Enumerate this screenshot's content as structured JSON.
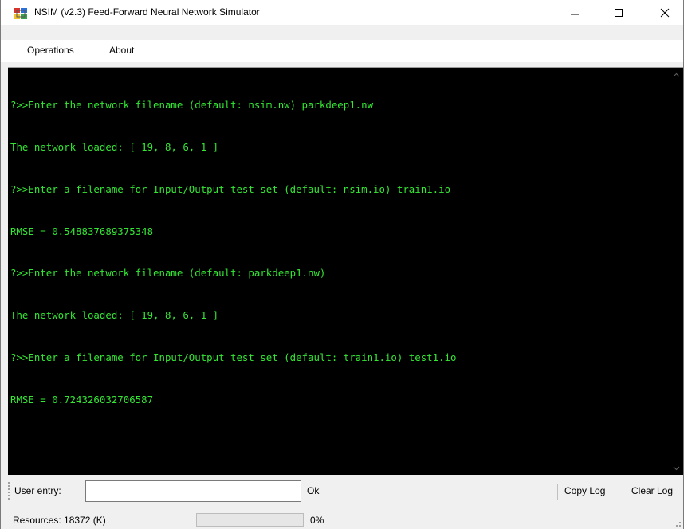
{
  "window": {
    "title": "NSIM (v2.3) Feed-Forward Neural Network Simulator",
    "icons": {
      "app": "app-window-icon",
      "minimize": "minimize-icon",
      "maximize": "maximize-icon",
      "close": "close-icon"
    }
  },
  "menu": {
    "items": [
      "Operations",
      "About"
    ]
  },
  "console": {
    "text_color": "#33e733",
    "background": "#000000",
    "lines": [
      "?>>Enter the network filename (default: nsim.nw) parkdeep1.nw",
      "The network loaded: [ 19, 8, 6, 1 ]",
      "?>>Enter a filename for Input/Output test set (default: nsim.io) train1.io",
      "RMSE = 0.548837689375348",
      "?>>Enter the network filename (default: parkdeep1.nw)",
      "The network loaded: [ 19, 8, 6, 1 ]",
      "?>>Enter a filename for Input/Output test set (default: train1.io) test1.io",
      "RMSE = 0.724326032706587"
    ]
  },
  "toolbar": {
    "user_entry_label": "User entry:",
    "user_entry_value": "",
    "ok_label": "Ok",
    "copy_log_label": "Copy Log",
    "clear_log_label": "Clear Log"
  },
  "status": {
    "resources_text": "Resources:  18372 (K)",
    "progress_percent": 0,
    "progress_text": "0%",
    "progress_color": "#06b025"
  }
}
